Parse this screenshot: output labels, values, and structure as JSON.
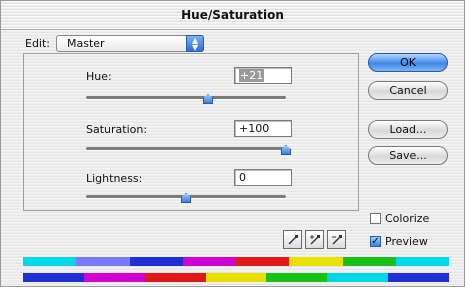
{
  "window": {
    "title": "Hue/Saturation"
  },
  "edit": {
    "label": "Edit:",
    "selected": "Master"
  },
  "hue": {
    "label": "Hue:",
    "value": "+21",
    "slider_fraction": 0.58
  },
  "saturation": {
    "label": "Saturation:",
    "value": "+100",
    "slider_fraction": 1.0
  },
  "lightness": {
    "label": "Lightness:",
    "value": "0",
    "slider_fraction": 0.5
  },
  "buttons": {
    "ok": "OK",
    "cancel": "Cancel",
    "load": "Load...",
    "save": "Save..."
  },
  "checkboxes": {
    "colorize": {
      "label": "Colorize",
      "checked": false
    },
    "preview": {
      "label": "Preview",
      "checked": true
    }
  },
  "icons": [
    "eyedropper-icon",
    "eyedropper-plus-icon",
    "eyedropper-minus-icon"
  ],
  "colors": {
    "spectrum_top": [
      "#00d7e8",
      "#7a7aff",
      "#1e2fd6",
      "#d000d0",
      "#e01818",
      "#e8e000",
      "#18c018",
      "#00d7e8"
    ],
    "spectrum_bottom": [
      "#1e2fd6",
      "#d000d0",
      "#e01818",
      "#e8e000",
      "#18c018",
      "#00d7e8",
      "#1e2fd6"
    ],
    "accent": "#3f87e6"
  }
}
